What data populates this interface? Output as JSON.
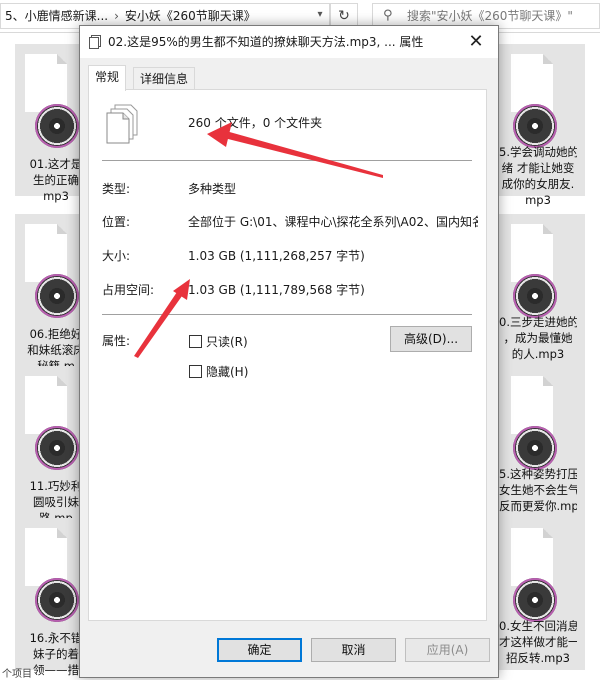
{
  "explorer": {
    "breadcrumb": [
      "5、小鹿情感新课...",
      "安小妖《260节聊天课》"
    ],
    "search_placeholder": "搜索\"安小妖《260节聊天课》\"",
    "status_text": "个项目",
    "tiles_left": [
      [
        "01.这才是",
        "生的正确",
        "mp3"
      ],
      [
        "06.拒绝好",
        "和妹纸滚床",
        "秘籍.m"
      ],
      [
        "11.巧妙利",
        "圆吸引妹",
        "路.mp"
      ],
      [
        "16.永不错",
        "妹子的着",
        "领——措"
      ]
    ],
    "tiles_right": [
      [
        "5.学会调动她的",
        "绪 才能让她变",
        "成你的女朋友.",
        "mp3"
      ],
      [
        "0.三步走进她的",
        "，成为最懂她",
        "的人.mp3"
      ],
      [
        "5.这种姿势打压",
        "女生她不会生气",
        "反而更爱你.mp3"
      ],
      [
        "0.女生不回消息",
        "才这样做才能一",
        "招反转.mp3"
      ]
    ]
  },
  "dialog": {
    "title": "02.这是95%的男生都不知道的撩妹聊天方法.mp3, ... 属性",
    "tabs": [
      "常规",
      "详细信息"
    ],
    "summary": "260 个文件，0 个文件夹",
    "rows": [
      {
        "label": "类型:",
        "value": "多种类型"
      },
      {
        "label": "位置:",
        "value": "全部位于 G:\\01、课程中心\\探花全系列\\A02、国内知名"
      },
      {
        "label": "大小:",
        "value": "1.03 GB (1,111,268,257 字节)"
      },
      {
        "label": "占用空间:",
        "value": "1.03 GB (1,111,789,568 字节)"
      }
    ],
    "attributes_label": "属性:",
    "readonly_label": "只读(R)",
    "hidden_label": "隐藏(H)",
    "advanced_label": "高级(D)...",
    "ok_label": "确定",
    "cancel_label": "取消",
    "apply_label": "应用(A)"
  },
  "colors": {
    "annotation_arrow": "#e8323c",
    "default_button_border": "#0078d7"
  }
}
